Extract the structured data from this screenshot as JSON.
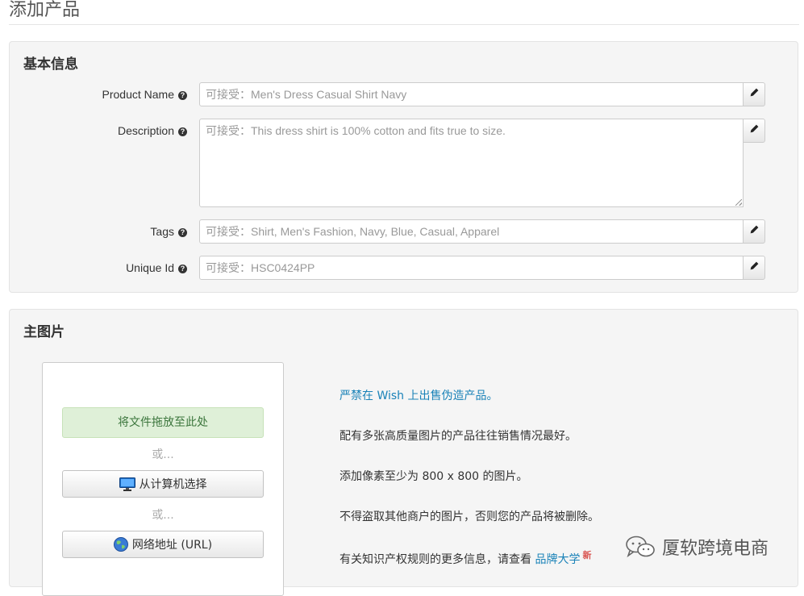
{
  "page": {
    "title": "添加产品"
  },
  "basic_info": {
    "heading": "基本信息",
    "fields": [
      {
        "label": "Product Name",
        "placeholder": "可接受：Men's Dress Casual Shirt Navy"
      },
      {
        "label": "Description",
        "placeholder": "可接受：This dress shirt is 100% cotton and fits true to size."
      },
      {
        "label": "Tags",
        "placeholder": "可接受：Shirt, Men's Fashion, Navy, Blue, Casual, Apparel"
      },
      {
        "label": "Unique Id",
        "placeholder": "可接受：HSC0424PP"
      }
    ],
    "help_glyph": "?"
  },
  "main_image": {
    "heading": "主图片",
    "dropzone_label": "将文件拖放至此处",
    "or_text": "或...",
    "computer_button": "从计算机选择",
    "url_button": "网络地址 (URL)",
    "info": {
      "warning": "严禁在 Wish 上出售伪造产品。",
      "tip1": "配有多张高质量图片的产品往往销售情况最好。",
      "tip2": "添加像素至少为 800 x 800 的图片。",
      "tip3": "不得盗取其他商户的图片，否则您的产品将被删除。",
      "ip_prefix": "有关知识产权规则的更多信息，请查看 ",
      "ip_link": "品牌大学",
      "new_badge": "新"
    }
  },
  "watermark": {
    "text": "厦软跨境电商"
  },
  "colors": {
    "link": "#1a82b8",
    "dropzone_bg": "#dff0d8",
    "dropzone_text": "#3c763d",
    "new_badge": "#d9534f"
  }
}
